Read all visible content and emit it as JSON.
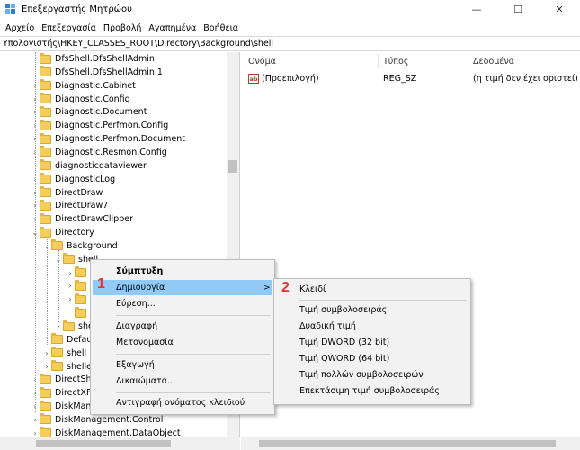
{
  "window": {
    "title": "Επεξεργαστής Μητρώου",
    "minimize": "—",
    "maximize": "☐",
    "close": "✕"
  },
  "menu": [
    "Αρχείο",
    "Επεξεργασία",
    "Προβολή",
    "Αγαπημένα",
    "Βοήθεια"
  ],
  "address": "Υπολογιστής\\HKEY_CLASSES_ROOT\\Directory\\Background\\shell",
  "tree": [
    {
      "label": "DfsShell.DfsShellAdmin",
      "level": 0,
      "expander": ""
    },
    {
      "label": "DfsShell.DfsShellAdmin.1",
      "level": 0,
      "expander": ""
    },
    {
      "label": "Diagnostic.Cabinet",
      "level": 0,
      "expander": ">"
    },
    {
      "label": "Diagnostic.Config",
      "level": 0,
      "expander": ">"
    },
    {
      "label": "Diagnostic.Document",
      "level": 0,
      "expander": ">"
    },
    {
      "label": "Diagnostic.Perfmon.Config",
      "level": 0,
      "expander": ">"
    },
    {
      "label": "Diagnostic.Perfmon.Document",
      "level": 0,
      "expander": ">"
    },
    {
      "label": "Diagnostic.Resmon.Config",
      "level": 0,
      "expander": ">"
    },
    {
      "label": "diagnosticdataviewer",
      "level": 0,
      "expander": ""
    },
    {
      "label": "DiagnosticLog",
      "level": 0,
      "expander": ">"
    },
    {
      "label": "DirectDraw",
      "level": 0,
      "expander": ">"
    },
    {
      "label": "DirectDraw7",
      "level": 0,
      "expander": ">"
    },
    {
      "label": "DirectDrawClipper",
      "level": 0,
      "expander": ">"
    },
    {
      "label": "Directory",
      "level": 0,
      "expander": "v"
    },
    {
      "label": "Background",
      "level": 1,
      "expander": "v"
    },
    {
      "label": "shell",
      "level": 2,
      "expander": "v"
    },
    {
      "label": "",
      "level": 3,
      "expander": ">"
    },
    {
      "label": "",
      "level": 3,
      "expander": ">"
    },
    {
      "label": "",
      "level": 3,
      "expander": ">"
    },
    {
      "label": "",
      "level": 3,
      "expander": ""
    },
    {
      "label": "she",
      "level": 2,
      "expander": ">"
    },
    {
      "label": "Defau",
      "level": 1,
      "expander": ""
    },
    {
      "label": "shell",
      "level": 1,
      "expander": ">"
    },
    {
      "label": "shelle",
      "level": 1,
      "expander": ">"
    },
    {
      "label": "DirectSho",
      "level": 0,
      "expander": ">"
    },
    {
      "label": "DirectXFi",
      "level": 0,
      "expander": ">"
    },
    {
      "label": "DiskMana",
      "level": 0,
      "expander": ">"
    },
    {
      "label": "DiskManagement.Control",
      "level": 0,
      "expander": ">"
    },
    {
      "label": "DiskManagement.DataObject",
      "level": 0,
      "expander": ">"
    }
  ],
  "columns": {
    "name": "Ονομα",
    "type": "Τύπος",
    "data": "Δεδομένα"
  },
  "values": [
    {
      "icon": "ab",
      "name": "(Προεπιλογή)",
      "type": "REG_SZ",
      "data": "(η τιμή δεν έχει οριστεί)"
    }
  ],
  "context_menu": {
    "collapse": "Σύμπτυξη",
    "new": "Δημιουργία",
    "find": "Εύρεση...",
    "delete": "Διαγραφή",
    "rename": "Μετονομασία",
    "export": "Εξαγωγή",
    "permissions": "Δικαιώματα...",
    "copy_key_name": "Αντιγραφή ονόματος κλειδιού",
    "arrow": ">"
  },
  "submenu": {
    "key": "Κλειδί",
    "string": "Τιμή συμβολοσειράς",
    "binary": "Δυαδική τιμή",
    "dword": "Τιμή DWORD (32 bit)",
    "qword": "Τιμή QWORD (64 bit)",
    "multi_string": "Τιμή πολλών συμβολοσειρών",
    "expandable_string": "Επεκτάσιμη τιμή συμβολοσειράς"
  },
  "markers": {
    "step1": "1",
    "step2": "2"
  },
  "colors": {
    "highlight": "#91c9f7",
    "marker": "#e5322d",
    "folder": "#f5cd5a"
  }
}
